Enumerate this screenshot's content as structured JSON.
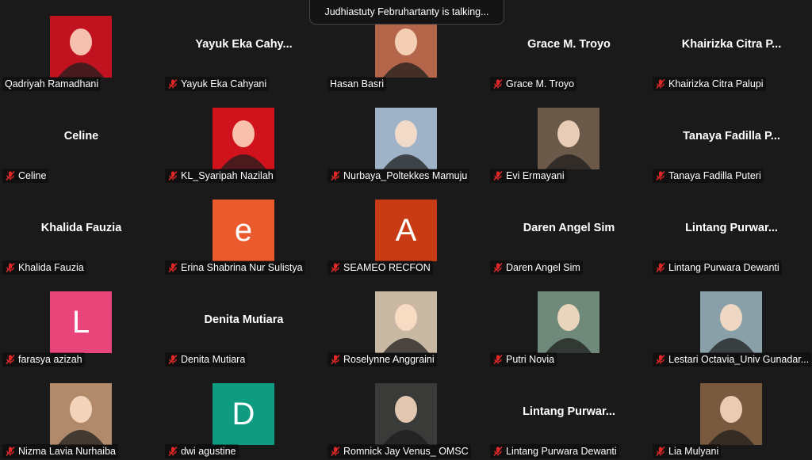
{
  "talking_banner": "Judhiastuty Februhartanty is talking...",
  "colors": {
    "background": "#1a1a1a",
    "muted_mic": "#e02828"
  },
  "participants": [
    {
      "label": "Qadriyah Ramadhani",
      "center_name": "",
      "avatar_type": "photo",
      "avatar_color": "#c1121f",
      "muted": false
    },
    {
      "label": "Yayuk Eka Cahyani",
      "center_name": "Yayuk  Eka  Cahy...",
      "avatar_type": "none",
      "avatar_color": "",
      "muted": true
    },
    {
      "label": "Hasan Basri",
      "center_name": "",
      "avatar_type": "photo",
      "avatar_color": "#b5654a",
      "muted": false
    },
    {
      "label": "Grace M. Troyo",
      "center_name": "Grace M. Troyo",
      "avatar_type": "none",
      "avatar_color": "",
      "muted": true
    },
    {
      "label": "Khairizka Citra Palupi",
      "center_name": "Khairizka  Citra  P...",
      "avatar_type": "none",
      "avatar_color": "",
      "muted": true
    },
    {
      "label": "Celine",
      "center_name": "Celine",
      "avatar_type": "none",
      "avatar_color": "",
      "muted": true
    },
    {
      "label": "KL_Syaripah Nazilah",
      "center_name": "",
      "avatar_type": "photo",
      "avatar_color": "#d0121c",
      "muted": true
    },
    {
      "label": "Nurbaya_Poltekkes Mamuju",
      "center_name": "",
      "avatar_type": "photo",
      "avatar_color": "#9fb3c8",
      "muted": true
    },
    {
      "label": "Evi Ermayani",
      "center_name": "",
      "avatar_type": "photo",
      "avatar_color": "#6b5a4a",
      "muted": true
    },
    {
      "label": "Tanaya Fadilla Puteri",
      "center_name": "Tanaya  Fadilla  P...",
      "avatar_type": "none",
      "avatar_color": "",
      "muted": true
    },
    {
      "label": "Khalida Fauzia",
      "center_name": "Khalida Fauzia",
      "avatar_type": "none",
      "avatar_color": "",
      "muted": true
    },
    {
      "label": "Erina Shabrina Nur Sulistya",
      "center_name": "",
      "avatar_type": "letter",
      "avatar_letter": "e",
      "avatar_color": "#ea5a2c",
      "muted": true
    },
    {
      "label": "SEAMEO RECFON",
      "center_name": "",
      "avatar_type": "letter",
      "avatar_letter": "A",
      "avatar_color": "#c83b14",
      "muted": true
    },
    {
      "label": "Daren Angel Sim",
      "center_name": "Daren Angel Sim",
      "avatar_type": "none",
      "avatar_color": "",
      "muted": true
    },
    {
      "label": "Lintang Purwara Dewanti",
      "center_name": "Lintang  Purwar...",
      "avatar_type": "none",
      "avatar_color": "",
      "muted": true
    },
    {
      "label": "farasya azizah",
      "center_name": "",
      "avatar_type": "letter",
      "avatar_letter": "L",
      "avatar_color": "#e8467a",
      "muted": true
    },
    {
      "label": "Denita Mutiara",
      "center_name": "Denita Mutiara",
      "avatar_type": "none",
      "avatar_color": "",
      "muted": true
    },
    {
      "label": "Roselynne Anggraini",
      "center_name": "",
      "avatar_type": "photo",
      "avatar_color": "#c9b8a4",
      "muted": true
    },
    {
      "label": "Putri Novia",
      "center_name": "",
      "avatar_type": "photo",
      "avatar_color": "#6f8a7a",
      "muted": true
    },
    {
      "label": "Lestari Octavia_Univ Gunadar...",
      "center_name": "",
      "avatar_type": "photo",
      "avatar_color": "#8aa0a8",
      "muted": true
    },
    {
      "label": "Nizma Lavia Nurhaiba",
      "center_name": "",
      "avatar_type": "photo",
      "avatar_color": "#b08a6a",
      "muted": true
    },
    {
      "label": "dwi agustine",
      "center_name": "",
      "avatar_type": "letter",
      "avatar_letter": "D",
      "avatar_color": "#0f9b80",
      "muted": true
    },
    {
      "label": "Romnick Jay Venus_ OMSC",
      "center_name": "",
      "avatar_type": "photo",
      "avatar_color": "#3a3a38",
      "muted": true
    },
    {
      "label": "Lintang Purwara Dewanti",
      "center_name": "Lintang  Purwar...",
      "avatar_type": "none",
      "avatar_color": "",
      "muted": true
    },
    {
      "label": "Lia Mulyani",
      "center_name": "",
      "avatar_type": "photo",
      "avatar_color": "#7a5a3e",
      "muted": true
    }
  ]
}
